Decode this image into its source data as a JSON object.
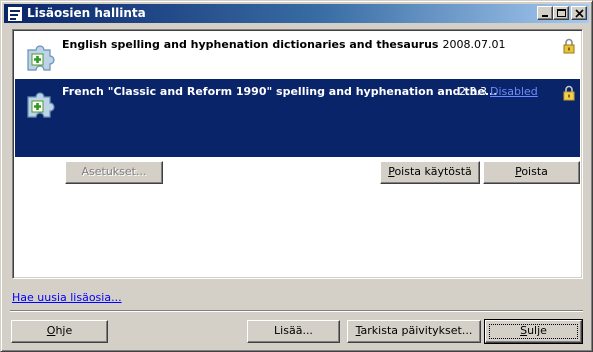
{
  "window": {
    "title": "Lisäosien hallinta",
    "icon": "app-logo-icon"
  },
  "titlebar_buttons": {
    "minimize": "minimize-icon",
    "maximize": "maximize-icon",
    "close": "close-icon"
  },
  "extensions": [
    {
      "name": "English spelling and hyphenation dictionaries and thesaurus",
      "version": "2008.07.01",
      "icon": "puzzle-piece-icon",
      "lock": "lock-icon",
      "selected": false
    },
    {
      "name": "French \"Classic and Reform 1990\" spelling and hyphenation and the...",
      "version": "2.3.3",
      "status_link": "Disabled",
      "icon": "puzzle-piece-icon",
      "lock": "lock-icon",
      "selected": true
    }
  ],
  "item_buttons": {
    "settings": "Asetukset...",
    "disable_prefix": "P",
    "disable_rest": "oista käytöstä",
    "remove_prefix": "P",
    "remove_rest": "oista"
  },
  "get_more_link": "Hae uusia lisäosia...",
  "footer": {
    "help_prefix": "O",
    "help_rest": "hje",
    "add": "Lisää...",
    "check_prefix": "T",
    "check_rest": "arkista päivitykset...",
    "close_prefix": "S",
    "close_rest": "ulje"
  },
  "colors": {
    "selection": "#0a246a",
    "title_gradient_start": "#0a246a",
    "title_gradient_end": "#a6caf0",
    "link": "#0000ff"
  }
}
